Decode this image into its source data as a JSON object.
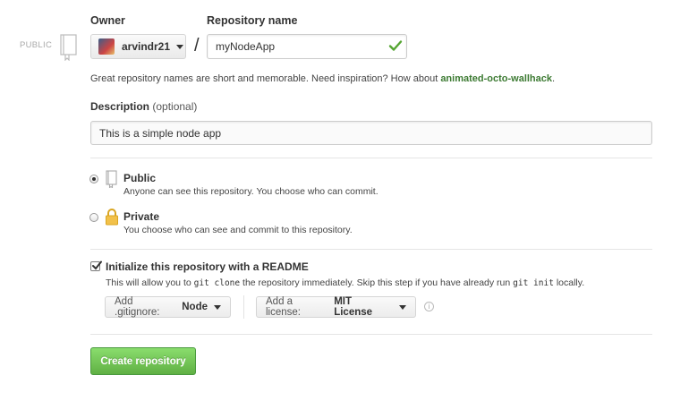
{
  "side": {
    "visibility_label": "PUBLIC"
  },
  "owner": {
    "label": "Owner",
    "value": "arvindr21"
  },
  "repo": {
    "label": "Repository name",
    "value": "myNodeApp",
    "hint_prefix": "Great repository names are short and memorable. Need inspiration? How about ",
    "hint_suggestion": "animated-octo-wallhack",
    "hint_suffix": "."
  },
  "description": {
    "label": "Description",
    "optional": "(optional)",
    "value": "This is a simple node app"
  },
  "visibility": {
    "public": {
      "title": "Public",
      "desc": "Anyone can see this repository. You choose who can commit.",
      "selected": true
    },
    "private": {
      "title": "Private",
      "desc": "You choose who can see and commit to this repository.",
      "selected": false
    }
  },
  "readme": {
    "title": "Initialize this repository with a README",
    "desc_1": "This will allow you to ",
    "code_1": "git clone",
    "desc_2": " the repository immediately. Skip this step if you have already run ",
    "code_2": "git init",
    "desc_3": " locally.",
    "checked": true
  },
  "gitignore": {
    "prefix": "Add .gitignore:",
    "value": "Node"
  },
  "license": {
    "prefix": "Add a license:",
    "value": "MIT License"
  },
  "info_icon": "i",
  "create_button": "Create repository",
  "colors": {
    "accent_green": "#60b044",
    "hint_green": "#3c7a32",
    "check_green": "#55a532"
  }
}
